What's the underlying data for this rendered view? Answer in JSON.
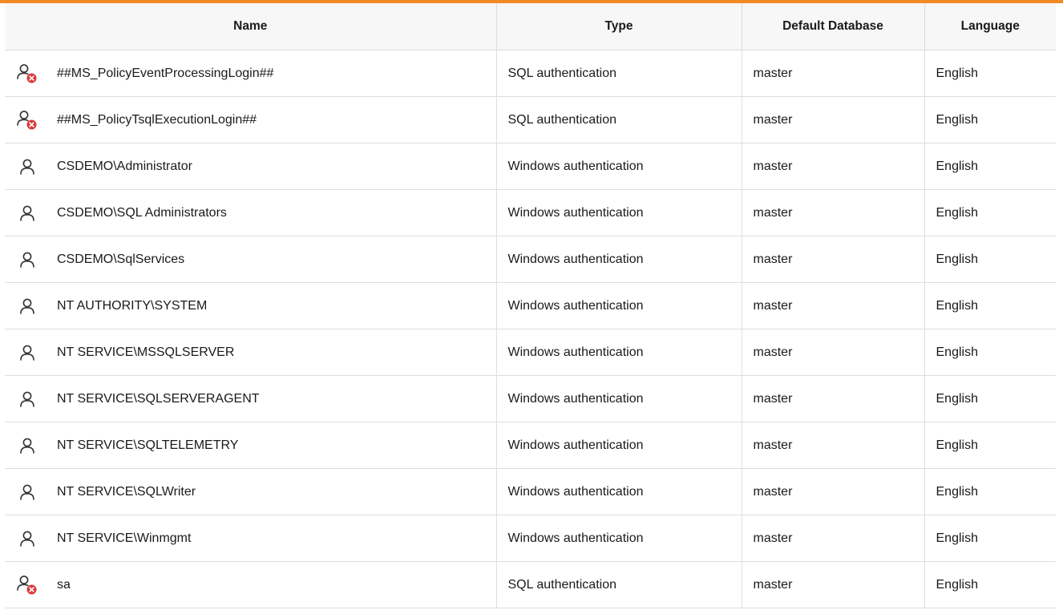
{
  "accent_color": "#f08a24",
  "columns": [
    "Name",
    "Type",
    "Default Database",
    "Language"
  ],
  "rows": [
    {
      "icon": "user-disabled-icon",
      "name": "##MS_PolicyEventProcessingLogin##",
      "type": "SQL authentication",
      "default_database": "master",
      "language": "English"
    },
    {
      "icon": "user-disabled-icon",
      "name": "##MS_PolicyTsqlExecutionLogin##",
      "type": "SQL authentication",
      "default_database": "master",
      "language": "English"
    },
    {
      "icon": "user-icon",
      "name": "CSDEMO\\Administrator",
      "type": "Windows authentication",
      "default_database": "master",
      "language": "English"
    },
    {
      "icon": "user-icon",
      "name": "CSDEMO\\SQL Administrators",
      "type": "Windows authentication",
      "default_database": "master",
      "language": "English"
    },
    {
      "icon": "user-icon",
      "name": "CSDEMO\\SqlServices",
      "type": "Windows authentication",
      "default_database": "master",
      "language": "English"
    },
    {
      "icon": "user-icon",
      "name": "NT AUTHORITY\\SYSTEM",
      "type": "Windows authentication",
      "default_database": "master",
      "language": "English"
    },
    {
      "icon": "user-icon",
      "name": "NT SERVICE\\MSSQLSERVER",
      "type": "Windows authentication",
      "default_database": "master",
      "language": "English"
    },
    {
      "icon": "user-icon",
      "name": "NT SERVICE\\SQLSERVERAGENT",
      "type": "Windows authentication",
      "default_database": "master",
      "language": "English"
    },
    {
      "icon": "user-icon",
      "name": "NT SERVICE\\SQLTELEMETRY",
      "type": "Windows authentication",
      "default_database": "master",
      "language": "English"
    },
    {
      "icon": "user-icon",
      "name": "NT SERVICE\\SQLWriter",
      "type": "Windows authentication",
      "default_database": "master",
      "language": "English"
    },
    {
      "icon": "user-icon",
      "name": "NT SERVICE\\Winmgmt",
      "type": "Windows authentication",
      "default_database": "master",
      "language": "English"
    },
    {
      "icon": "user-disabled-icon",
      "name": "sa",
      "type": "SQL authentication",
      "default_database": "master",
      "language": "English"
    }
  ]
}
